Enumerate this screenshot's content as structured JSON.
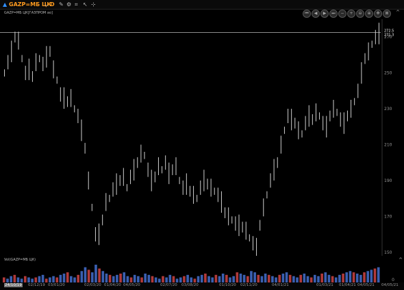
{
  "toolbar": {
    "symbol": "GAZP=МБ ЦК",
    "interval": "D"
  },
  "chart": {
    "header": "GAZP=МБ ЦК[ГАЗПРОМ ао]",
    "price_tags": [
      "272.5",
      "271.3",
      "270"
    ],
    "volume_header": "Vol(GAZP=МБ ЦК)",
    "volume_scale_label": "0"
  },
  "chart_data": {
    "type": "line",
    "title": "",
    "y_ticks": [
      150,
      170,
      190,
      210,
      230,
      250,
      270
    ],
    "ylim": [
      148,
      280
    ],
    "x_ticks": [
      "24/10/19",
      "02/12/19",
      "03/01/20",
      "02/03/20",
      "01/04/20",
      "04/05/20",
      "02/07/20",
      "03/08/20",
      "01/10/20",
      "02/11/20",
      "04/01/21",
      "01/03/21",
      "01/04/21",
      "04/05/21",
      "04/05/21"
    ],
    "active_x_tick": 0,
    "series": [
      {
        "values": [
          250,
          256,
          262,
          270,
          268,
          258,
          250,
          252,
          248,
          256,
          258,
          255,
          259,
          262,
          252,
          246,
          238,
          236,
          234,
          236,
          230,
          226,
          218,
          208,
          190,
          175,
          160,
          160,
          168,
          178,
          180,
          185,
          188,
          190,
          192,
          186,
          192,
          196,
          200,
          205,
          204,
          196,
          190,
          192,
          198,
          196,
          200,
          194,
          196,
          198,
          190,
          186,
          188,
          184,
          182,
          180,
          186,
          190,
          188,
          186,
          184,
          182,
          178,
          172,
          170,
          168,
          166,
          165,
          164,
          162,
          158,
          155,
          152,
          165,
          175,
          182,
          190,
          196,
          200,
          210,
          218,
          226,
          224,
          222,
          218,
          216,
          222,
          226,
          224,
          228,
          226,
          222,
          220,
          226,
          230,
          228,
          224,
          222,
          226,
          230,
          234,
          240,
          250,
          258,
          262,
          266,
          270,
          272
        ]
      }
    ],
    "volume": [
      4,
      3,
      5,
      6,
      4,
      3,
      5,
      4,
      3,
      4,
      5,
      6,
      3,
      4,
      5,
      4,
      6,
      7,
      8,
      5,
      4,
      6,
      9,
      12,
      10,
      8,
      14,
      11,
      9,
      7,
      6,
      5,
      6,
      7,
      8,
      5,
      4,
      6,
      5,
      4,
      7,
      6,
      5,
      4,
      3,
      5,
      4,
      6,
      5,
      3,
      4,
      5,
      6,
      4,
      3,
      5,
      6,
      7,
      5,
      4,
      6,
      5,
      7,
      6,
      4,
      5,
      8,
      7,
      6,
      5,
      9,
      8,
      6,
      5,
      7,
      6,
      5,
      4,
      6,
      7,
      8,
      6,
      5,
      4,
      6,
      7,
      5,
      4,
      6,
      5,
      7,
      8,
      6,
      5,
      4,
      6,
      7,
      8,
      9,
      8,
      7,
      6,
      8,
      9,
      10,
      11,
      12
    ]
  }
}
